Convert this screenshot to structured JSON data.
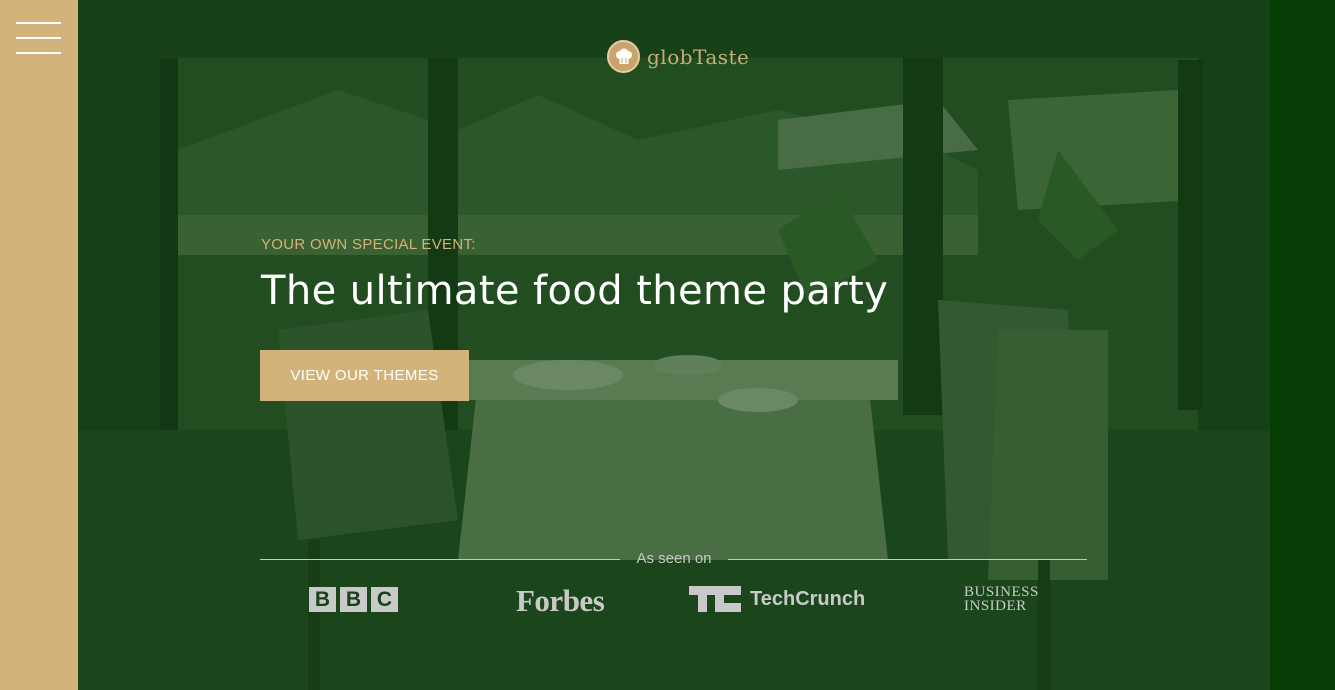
{
  "nav": {
    "menu_icon": "hamburger-menu-icon"
  },
  "brand": {
    "name": "globTaste",
    "logo_icon": "chef-hat-icon"
  },
  "hero": {
    "eyebrow": "YOUR OWN SPECIAL EVENT:",
    "headline": "The ultimate food theme party",
    "cta_label": "VIEW OUR THEMES"
  },
  "press": {
    "label": "As seen on",
    "bbc_letters": [
      "B",
      "B",
      "C"
    ],
    "forbes": "Forbes",
    "techcrunch": "TechCrunch",
    "business_insider_line1": "BUSINESS",
    "business_insider_line2": "INSIDER"
  },
  "colors": {
    "gold": "#d2b37a",
    "hero_overlay": "#0c3a0c",
    "right_band": "#053d05",
    "text_light": "#ffffff",
    "press_gray": "#c9c9c9"
  }
}
